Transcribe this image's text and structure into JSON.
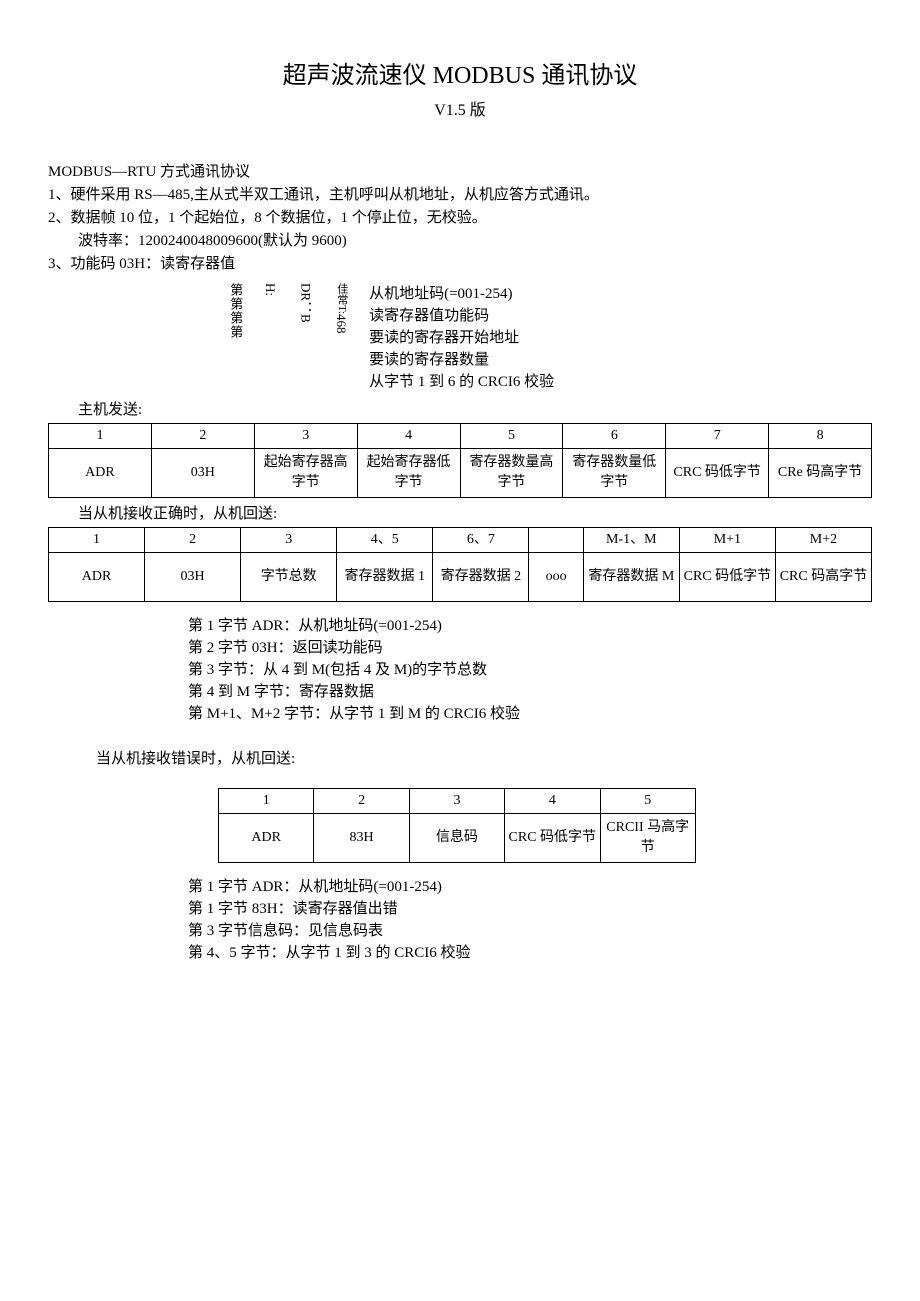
{
  "title": "超声波流速仪 MODBUS 通讯协议",
  "version": "V1.5 版",
  "heading": "MODBUS—RTU 方式通讯协议",
  "p1": "1、硬件采用 RS—485,主从式半双工通讯，主机呼叫从机地址，从机应答方式通讯。",
  "p2": "2、数据帧 10 位，1 个起始位，8 个数据位，1 个停止位，无校验。",
  "p2b": "波特率：1200240048009600(默认为 9600)",
  "p3": "3、功能码 03H：读寄存器值",
  "rot": {
    "c1": "第第第第",
    "c2": "H:",
    "c3": "DR：B",
    "c4": "佳常T:",
    "c5": "468"
  },
  "rlist": {
    "r1": "从机地址码(=001-254)",
    "r2": "读寄存器值功能码",
    "r3": "要读的寄存器开始地址",
    "r4": "要读的寄存器数量",
    "r5": "从字节 1 到 6 的 CRCI6 校验"
  },
  "send_label": "主机发送:",
  "t1_h": [
    "1",
    "2",
    "3",
    "4",
    "5",
    "6",
    "7",
    "8"
  ],
  "t1_r": [
    "ADR",
    "03H",
    "起始寄存器高字节",
    "起始寄存器低字节",
    "寄存器数量高字节",
    "寄存器数量低字节",
    "CRC 码低字节",
    "CRe 码高字节"
  ],
  "recv_ok_label": "当从机接收正确时，从机回送:",
  "t2_h": [
    "1",
    "2",
    "3",
    "4、5",
    "6、7",
    "",
    "M-1、M",
    "M+1",
    "M+2"
  ],
  "t2_r": [
    "ADR",
    "03H",
    "字节总数",
    "寄存器数据 1",
    "寄存器数据 2",
    "ooo",
    "寄存器数据 M",
    "CRC 码低字节",
    "CRC 码高字节"
  ],
  "notes1": {
    "n1": "第 1 字节 ADR：从机地址码(=001-254)",
    "n2": "第 2 字节 03H：返回读功能码",
    "n3": "第 3 字节：从 4 到 M(包括 4 及 M)的字节总数",
    "n4": "第 4 到 M 字节：寄存器数据",
    "n5": "第 M+1、M+2 字节：从字节 1 到 M 的 CRCI6 校验"
  },
  "recv_err_label": "当从机接收错误时，从机回送:",
  "t3_h": [
    "1",
    "2",
    "3",
    "4",
    "5"
  ],
  "t3_r": [
    "ADR",
    "83H",
    "信息码",
    "CRC 码低字节",
    "CRCII 马高字节"
  ],
  "notes2": {
    "n1": "第 1 字节 ADR：从机地址码(=001-254)",
    "n2": "第 1 字节 83H：读寄存器值出错",
    "n3": "第 3 字节信息码：见信息码表",
    "n4": "第 4、5 字节：从字节 1 到 3 的 CRCI6 校验"
  }
}
